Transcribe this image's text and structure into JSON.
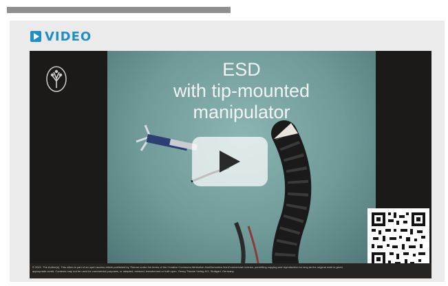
{
  "section": {
    "label": "VIDEO",
    "accent_color": "#1e8ec8"
  },
  "video": {
    "title_line_1": "ESD",
    "title_line_2": "with tip-mounted",
    "title_line_3": "manipulator",
    "play_icon": "play-icon",
    "qr_icon": "qr-code-icon",
    "emblem_icon": "tree-emblem-icon",
    "caption": "© 2021. The Author(s). This video is part of an open access article published by Thieme under the terms of the Creative Commons Attribution-NonDerivative-NonCommercial License, permitting copying and reproduction so long as the original work is given appropriate credit. Contents may not be used for commercial purposes, or adapted, remixed, transformed or built upon. Georg Thieme Verlag KG, Stuttgart, Germany."
  }
}
